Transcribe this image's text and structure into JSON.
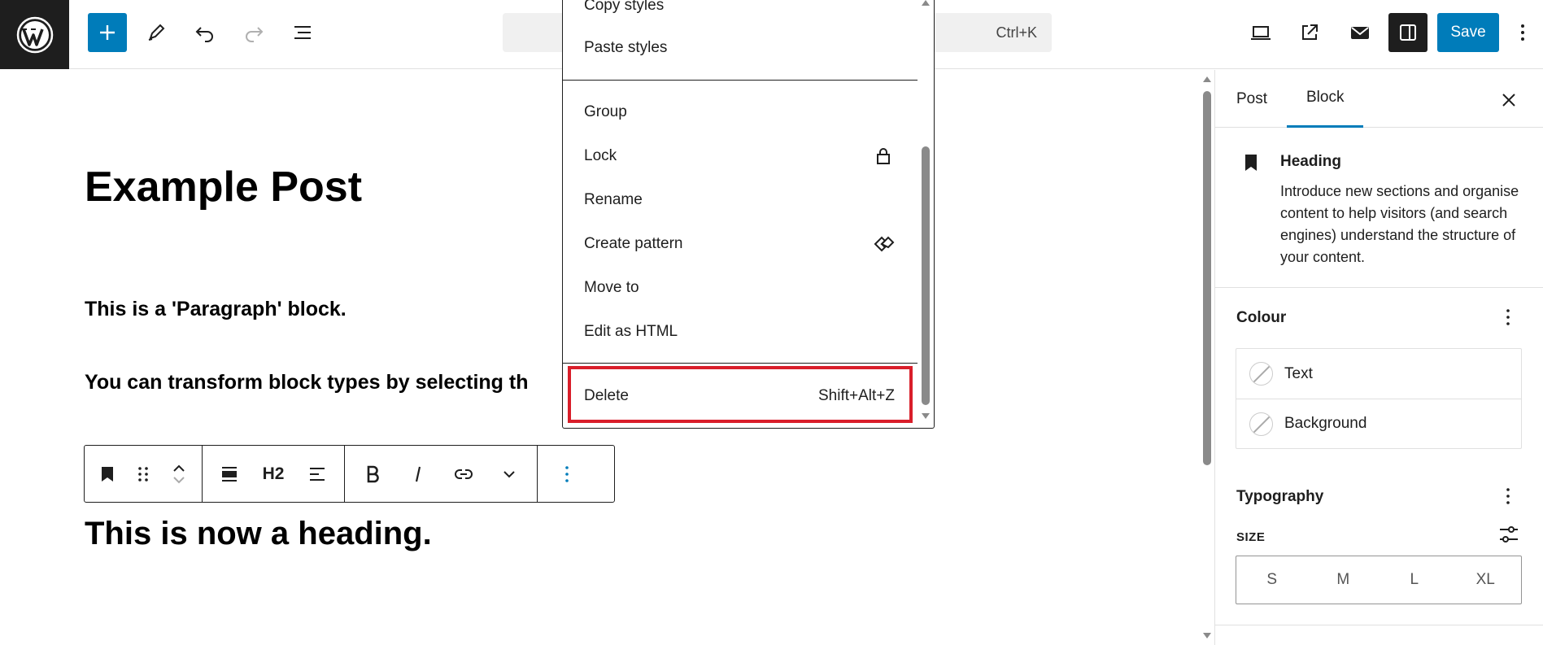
{
  "topbar": {
    "search_shortcut": "Ctrl+K",
    "save_label": "Save"
  },
  "post": {
    "title": "Example Post",
    "paragraph_1": "This is a 'Paragraph' block.",
    "paragraph_2": "You can transform block types by selecting th",
    "heading": "This is now a heading."
  },
  "block_toolbar": {
    "heading_level": "H2"
  },
  "menu": {
    "items_top": [
      "Copy styles",
      "Paste styles"
    ],
    "items_mid": [
      {
        "label": "Group"
      },
      {
        "label": "Lock",
        "icon": "lock-icon"
      },
      {
        "label": "Rename"
      },
      {
        "label": "Create pattern",
        "icon": "pattern-icon"
      },
      {
        "label": "Move to"
      },
      {
        "label": "Edit as HTML"
      }
    ],
    "delete": {
      "label": "Delete",
      "shortcut": "Shift+Alt+Z"
    },
    "highlight_color": "#d91e2a"
  },
  "sidebar": {
    "tabs": [
      "Post",
      "Block"
    ],
    "active_tab": "Block",
    "block": {
      "title": "Heading",
      "description": "Introduce new sections and organise content to help visitors (and search engines) understand the structure of your content."
    },
    "colour": {
      "title": "Colour",
      "items": [
        "Text",
        "Background"
      ]
    },
    "typography": {
      "title": "Typography",
      "size_label": "SIZE",
      "sizes": [
        "S",
        "M",
        "L",
        "XL"
      ]
    }
  },
  "colors": {
    "accent": "#007cba",
    "dark": "#1e1e1e"
  }
}
